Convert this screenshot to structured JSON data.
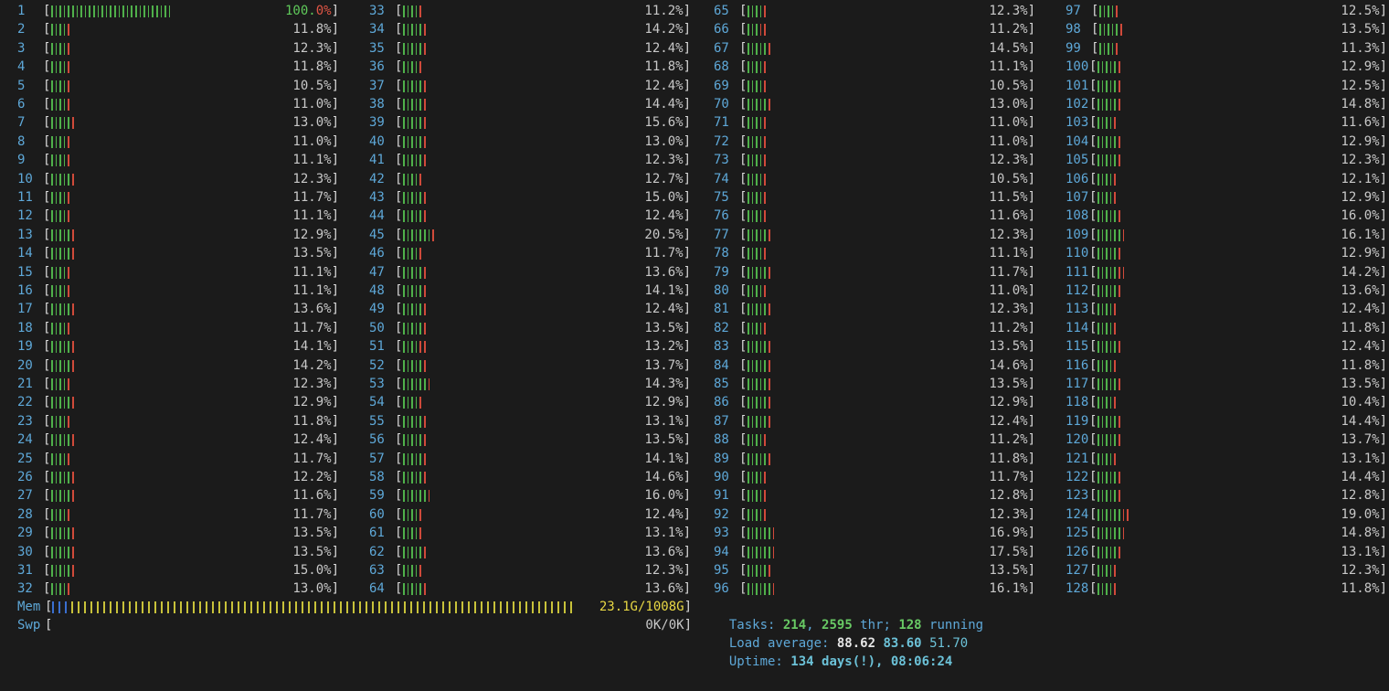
{
  "cpus": [
    {
      "id": "1",
      "pct": "100.0%",
      "g": 29,
      "r": 0
    },
    {
      "id": "2",
      "pct": "11.8%",
      "g": 4,
      "r": 1
    },
    {
      "id": "3",
      "pct": "12.3%",
      "g": 4,
      "r": 1
    },
    {
      "id": "4",
      "pct": "11.8%",
      "g": 4,
      "r": 1
    },
    {
      "id": "5",
      "pct": "10.5%",
      "g": 4,
      "r": 1
    },
    {
      "id": "6",
      "pct": "11.0%",
      "g": 4,
      "r": 1
    },
    {
      "id": "7",
      "pct": "13.0%",
      "g": 5,
      "r": 1
    },
    {
      "id": "8",
      "pct": "11.0%",
      "g": 4,
      "r": 1
    },
    {
      "id": "9",
      "pct": "11.1%",
      "g": 4,
      "r": 1
    },
    {
      "id": "10",
      "pct": "12.3%",
      "g": 5,
      "r": 1
    },
    {
      "id": "11",
      "pct": "11.7%",
      "g": 4,
      "r": 1
    },
    {
      "id": "12",
      "pct": "11.1%",
      "g": 4,
      "r": 1
    },
    {
      "id": "13",
      "pct": "12.9%",
      "g": 5,
      "r": 1
    },
    {
      "id": "14",
      "pct": "13.5%",
      "g": 5,
      "r": 1
    },
    {
      "id": "15",
      "pct": "11.1%",
      "g": 4,
      "r": 1
    },
    {
      "id": "16",
      "pct": "11.1%",
      "g": 4,
      "r": 1
    },
    {
      "id": "17",
      "pct": "13.6%",
      "g": 5,
      "r": 1
    },
    {
      "id": "18",
      "pct": "11.7%",
      "g": 4,
      "r": 1
    },
    {
      "id": "19",
      "pct": "14.1%",
      "g": 5,
      "r": 1
    },
    {
      "id": "20",
      "pct": "14.2%",
      "g": 5,
      "r": 1
    },
    {
      "id": "21",
      "pct": "12.3%",
      "g": 4,
      "r": 1
    },
    {
      "id": "22",
      "pct": "12.9%",
      "g": 5,
      "r": 1
    },
    {
      "id": "23",
      "pct": "11.8%",
      "g": 4,
      "r": 1
    },
    {
      "id": "24",
      "pct": "12.4%",
      "g": 5,
      "r": 1
    },
    {
      "id": "25",
      "pct": "11.7%",
      "g": 4,
      "r": 1
    },
    {
      "id": "26",
      "pct": "12.2%",
      "g": 5,
      "r": 1
    },
    {
      "id": "27",
      "pct": "11.6%",
      "g": 5,
      "r": 1
    },
    {
      "id": "28",
      "pct": "11.7%",
      "g": 4,
      "r": 1
    },
    {
      "id": "29",
      "pct": "13.5%",
      "g": 5,
      "r": 1
    },
    {
      "id": "30",
      "pct": "13.5%",
      "g": 5,
      "r": 1
    },
    {
      "id": "31",
      "pct": "15.0%",
      "g": 5,
      "r": 1
    },
    {
      "id": "32",
      "pct": "13.0%",
      "g": 4,
      "r": 1
    },
    {
      "id": "33",
      "pct": "11.2%",
      "g": 4,
      "r": 1
    },
    {
      "id": "34",
      "pct": "14.2%",
      "g": 5,
      "r": 1
    },
    {
      "id": "35",
      "pct": "12.4%",
      "g": 5,
      "r": 1
    },
    {
      "id": "36",
      "pct": "11.8%",
      "g": 4,
      "r": 1
    },
    {
      "id": "37",
      "pct": "12.4%",
      "g": 5,
      "r": 1
    },
    {
      "id": "38",
      "pct": "14.4%",
      "g": 5,
      "r": 1
    },
    {
      "id": "39",
      "pct": "15.6%",
      "g": 5,
      "r": 1
    },
    {
      "id": "40",
      "pct": "13.0%",
      "g": 5,
      "r": 1
    },
    {
      "id": "41",
      "pct": "12.3%",
      "g": 5,
      "r": 1
    },
    {
      "id": "42",
      "pct": "12.7%",
      "g": 4,
      "r": 1
    },
    {
      "id": "43",
      "pct": "15.0%",
      "g": 5,
      "r": 1
    },
    {
      "id": "44",
      "pct": "12.4%",
      "g": 5,
      "r": 1
    },
    {
      "id": "45",
      "pct": "20.5%",
      "g": 7,
      "r": 1
    },
    {
      "id": "46",
      "pct": "11.7%",
      "g": 4,
      "r": 1
    },
    {
      "id": "47",
      "pct": "13.6%",
      "g": 5,
      "r": 1
    },
    {
      "id": "48",
      "pct": "14.1%",
      "g": 5,
      "r": 1
    },
    {
      "id": "49",
      "pct": "12.4%",
      "g": 5,
      "r": 1
    },
    {
      "id": "50",
      "pct": "13.5%",
      "g": 5,
      "r": 1
    },
    {
      "id": "51",
      "pct": "13.2%",
      "g": 4,
      "r": 2
    },
    {
      "id": "52",
      "pct": "13.7%",
      "g": 5,
      "r": 1
    },
    {
      "id": "53",
      "pct": "14.3%",
      "g": 6,
      "r": 1
    },
    {
      "id": "54",
      "pct": "12.9%",
      "g": 4,
      "r": 1
    },
    {
      "id": "55",
      "pct": "13.1%",
      "g": 5,
      "r": 1
    },
    {
      "id": "56",
      "pct": "13.5%",
      "g": 5,
      "r": 1
    },
    {
      "id": "57",
      "pct": "14.1%",
      "g": 5,
      "r": 1
    },
    {
      "id": "58",
      "pct": "14.6%",
      "g": 5,
      "r": 1
    },
    {
      "id": "59",
      "pct": "16.0%",
      "g": 6,
      "r": 1
    },
    {
      "id": "60",
      "pct": "12.4%",
      "g": 4,
      "r": 1
    },
    {
      "id": "61",
      "pct": "13.1%",
      "g": 4,
      "r": 1
    },
    {
      "id": "62",
      "pct": "13.6%",
      "g": 5,
      "r": 1
    },
    {
      "id": "63",
      "pct": "12.3%",
      "g": 4,
      "r": 1
    },
    {
      "id": "64",
      "pct": "13.6%",
      "g": 5,
      "r": 1
    },
    {
      "id": "65",
      "pct": "12.3%",
      "g": 4,
      "r": 1
    },
    {
      "id": "66",
      "pct": "11.2%",
      "g": 3,
      "r": 2
    },
    {
      "id": "67",
      "pct": "14.5%",
      "g": 5,
      "r": 1
    },
    {
      "id": "68",
      "pct": "11.1%",
      "g": 4,
      "r": 1
    },
    {
      "id": "69",
      "pct": "10.5%",
      "g": 4,
      "r": 1
    },
    {
      "id": "70",
      "pct": "13.0%",
      "g": 5,
      "r": 1
    },
    {
      "id": "71",
      "pct": "11.0%",
      "g": 4,
      "r": 1
    },
    {
      "id": "72",
      "pct": "11.0%",
      "g": 4,
      "r": 1
    },
    {
      "id": "73",
      "pct": "12.3%",
      "g": 4,
      "r": 1
    },
    {
      "id": "74",
      "pct": "10.5%",
      "g": 4,
      "r": 1
    },
    {
      "id": "75",
      "pct": "11.5%",
      "g": 4,
      "r": 1
    },
    {
      "id": "76",
      "pct": "11.6%",
      "g": 4,
      "r": 1
    },
    {
      "id": "77",
      "pct": "12.3%",
      "g": 5,
      "r": 1
    },
    {
      "id": "78",
      "pct": "11.1%",
      "g": 4,
      "r": 1
    },
    {
      "id": "79",
      "pct": "11.7%",
      "g": 5,
      "r": 1
    },
    {
      "id": "80",
      "pct": "11.0%",
      "g": 4,
      "r": 1
    },
    {
      "id": "81",
      "pct": "12.3%",
      "g": 5,
      "r": 1
    },
    {
      "id": "82",
      "pct": "11.2%",
      "g": 4,
      "r": 1
    },
    {
      "id": "83",
      "pct": "13.5%",
      "g": 5,
      "r": 1
    },
    {
      "id": "84",
      "pct": "14.6%",
      "g": 5,
      "r": 1
    },
    {
      "id": "85",
      "pct": "13.5%",
      "g": 5,
      "r": 1
    },
    {
      "id": "86",
      "pct": "12.9%",
      "g": 5,
      "r": 1
    },
    {
      "id": "87",
      "pct": "12.4%",
      "g": 5,
      "r": 1
    },
    {
      "id": "88",
      "pct": "11.2%",
      "g": 4,
      "r": 1
    },
    {
      "id": "89",
      "pct": "11.8%",
      "g": 5,
      "r": 1
    },
    {
      "id": "90",
      "pct": "11.7%",
      "g": 4,
      "r": 1
    },
    {
      "id": "91",
      "pct": "12.8%",
      "g": 4,
      "r": 1
    },
    {
      "id": "92",
      "pct": "12.3%",
      "g": 4,
      "r": 1
    },
    {
      "id": "93",
      "pct": "16.9%",
      "g": 6,
      "r": 1
    },
    {
      "id": "94",
      "pct": "17.5%",
      "g": 6,
      "r": 1
    },
    {
      "id": "95",
      "pct": "13.5%",
      "g": 5,
      "r": 1
    },
    {
      "id": "96",
      "pct": "16.1%",
      "g": 6,
      "r": 1
    },
    {
      "id": "97",
      "pct": "12.5%",
      "g": 4,
      "r": 1
    },
    {
      "id": "98",
      "pct": "13.5%",
      "g": 5,
      "r": 1
    },
    {
      "id": "99",
      "pct": "11.3%",
      "g": 4,
      "r": 1
    },
    {
      "id": "100",
      "pct": "12.9%",
      "g": 5,
      "r": 1
    },
    {
      "id": "101",
      "pct": "12.5%",
      "g": 5,
      "r": 1
    },
    {
      "id": "102",
      "pct": "14.8%",
      "g": 5,
      "r": 1
    },
    {
      "id": "103",
      "pct": "11.6%",
      "g": 4,
      "r": 1
    },
    {
      "id": "104",
      "pct": "12.9%",
      "g": 5,
      "r": 1
    },
    {
      "id": "105",
      "pct": "12.3%",
      "g": 5,
      "r": 1
    },
    {
      "id": "106",
      "pct": "12.1%",
      "g": 4,
      "r": 1
    },
    {
      "id": "107",
      "pct": "12.9%",
      "g": 4,
      "r": 1
    },
    {
      "id": "108",
      "pct": "16.0%",
      "g": 5,
      "r": 1
    },
    {
      "id": "109",
      "pct": "16.1%",
      "g": 6,
      "r": 1
    },
    {
      "id": "110",
      "pct": "12.9%",
      "g": 5,
      "r": 1
    },
    {
      "id": "111",
      "pct": "14.2%",
      "g": 5,
      "r": 2
    },
    {
      "id": "112",
      "pct": "13.6%",
      "g": 5,
      "r": 1
    },
    {
      "id": "113",
      "pct": "12.4%",
      "g": 4,
      "r": 1
    },
    {
      "id": "114",
      "pct": "11.8%",
      "g": 4,
      "r": 1
    },
    {
      "id": "115",
      "pct": "12.4%",
      "g": 5,
      "r": 1
    },
    {
      "id": "116",
      "pct": "11.8%",
      "g": 4,
      "r": 1
    },
    {
      "id": "117",
      "pct": "13.5%",
      "g": 5,
      "r": 1
    },
    {
      "id": "118",
      "pct": "10.4%",
      "g": 4,
      "r": 1
    },
    {
      "id": "119",
      "pct": "14.4%",
      "g": 5,
      "r": 1
    },
    {
      "id": "120",
      "pct": "13.7%",
      "g": 5,
      "r": 1
    },
    {
      "id": "121",
      "pct": "13.1%",
      "g": 4,
      "r": 1
    },
    {
      "id": "122",
      "pct": "14.4%",
      "g": 5,
      "r": 1
    },
    {
      "id": "123",
      "pct": "12.8%",
      "g": 5,
      "r": 1
    },
    {
      "id": "124",
      "pct": "19.0%",
      "g": 6,
      "r": 2
    },
    {
      "id": "125",
      "pct": "14.8%",
      "g": 6,
      "r": 1
    },
    {
      "id": "126",
      "pct": "13.1%",
      "g": 5,
      "r": 1
    },
    {
      "id": "127",
      "pct": "12.3%",
      "g": 4,
      "r": 1
    },
    {
      "id": "128",
      "pct": "11.8%",
      "g": 4,
      "r": 1
    }
  ],
  "mem": {
    "label": "Mem",
    "value": "23.1G/1008G",
    "blue_bars": 3,
    "yellow_bars": 79,
    "bracket_close": "]"
  },
  "swp": {
    "label": "Swp",
    "value": "0K/0K",
    "bracket_close": "]"
  },
  "tasks": {
    "label": "Tasks: ",
    "count": "214",
    "sep1": ", ",
    "threads": "2595",
    "thr_label": " thr; ",
    "running": "128",
    "running_label": " running"
  },
  "load": {
    "label": "Load average: ",
    "one": "88.62",
    "five": "83.60",
    "fifteen": "51.70"
  },
  "uptime": {
    "label": "Uptime: ",
    "value": "134 days(!), 08:06:24"
  },
  "colors": {
    "background": "#1b1b1b",
    "label": "#5ea8d8",
    "bar_green": "#4fb04a",
    "bar_red": "#d04a3a",
    "bar_blue": "#3a6fd0",
    "bar_yellow": "#c8c23a",
    "text": "#c8c8c8"
  }
}
